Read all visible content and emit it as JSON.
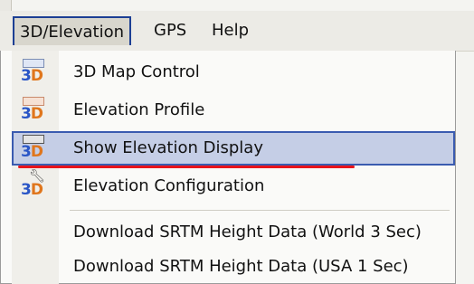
{
  "menubar": {
    "items": [
      {
        "label": "3D/Elevation",
        "active": true
      },
      {
        "label": "GPS",
        "active": false
      },
      {
        "label": "Help",
        "active": false
      }
    ]
  },
  "dropdown": {
    "items": [
      {
        "label": "3D Map Control",
        "icon": "3d-map-control-icon"
      },
      {
        "label": "Elevation Profile",
        "icon": "elevation-profile-icon"
      },
      {
        "label": "Show Elevation Display",
        "icon": "show-elevation-display-icon",
        "highlighted": true
      },
      {
        "label": "Elevation Configuration",
        "icon": "elevation-configuration-icon"
      },
      {
        "label": "Download SRTM Height Data (World 3 Sec)"
      },
      {
        "label": "Download SRTM Height Data (USA 1 Sec)"
      }
    ]
  },
  "icon_text": {
    "three": "3",
    "d": "D"
  },
  "left_fragments": [
    "3",
    "D"
  ],
  "colors": {
    "highlight": "#c5cee6",
    "highlight_border": "#3a5bb0",
    "annotation_underline": "#e8141b",
    "icon_blue": "#2a56c6",
    "icon_orange": "#e0761c"
  }
}
